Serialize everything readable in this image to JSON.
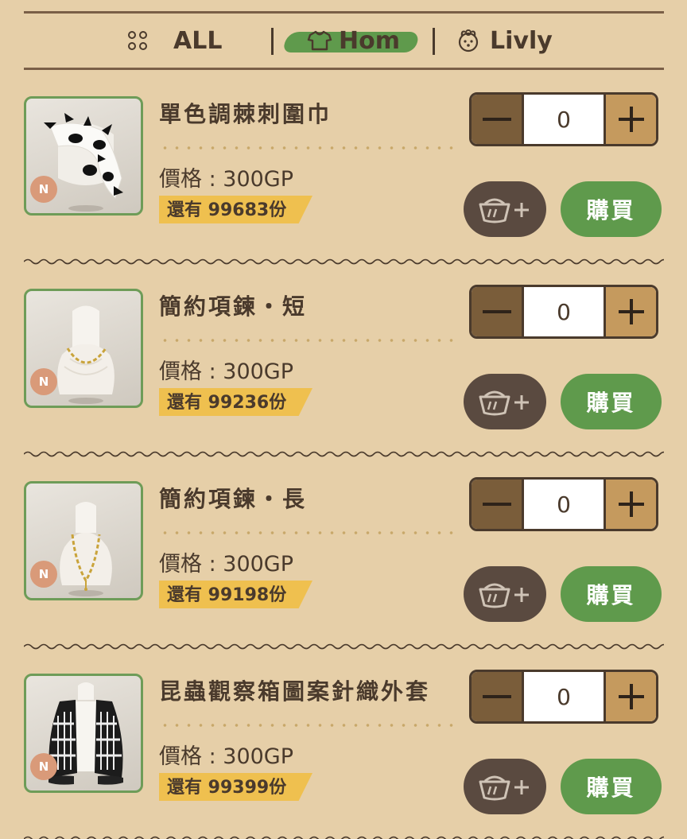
{
  "tabs": [
    {
      "label": "ALL",
      "icon": "grid-dots-icon",
      "active": false
    },
    {
      "label": "Hom",
      "icon": "shirt-icon",
      "active": true
    },
    {
      "label": "Livly",
      "icon": "livly-face-icon",
      "active": false
    }
  ],
  "colors": {
    "background": "#e6cfa8",
    "accent_green": "#5f9a4c",
    "dark_brown": "#4a3a2c",
    "stock_yellow": "#efc04f",
    "rarity": "#d99a79"
  },
  "items": [
    {
      "name": "單色調棘刺圍巾",
      "price": "價格 : 300GP",
      "stock": "還有 99683份",
      "rarity": "N",
      "quantity": "0",
      "buy_label": "購買",
      "basket_icon": "add-to-basket-icon"
    },
    {
      "name": "簡約項鍊・短",
      "price": "價格 : 300GP",
      "stock": "還有 99236份",
      "rarity": "N",
      "quantity": "0",
      "buy_label": "購買",
      "basket_icon": "add-to-basket-icon"
    },
    {
      "name": "簡約項鍊・長",
      "price": "價格 : 300GP",
      "stock": "還有 99198份",
      "rarity": "N",
      "quantity": "0",
      "buy_label": "購買",
      "basket_icon": "add-to-basket-icon"
    },
    {
      "name": "昆蟲觀察箱圖案針織外套",
      "price": "價格 : 300GP",
      "stock": "還有 99399份",
      "rarity": "N",
      "quantity": "0",
      "buy_label": "購買",
      "basket_icon": "add-to-basket-icon"
    }
  ]
}
